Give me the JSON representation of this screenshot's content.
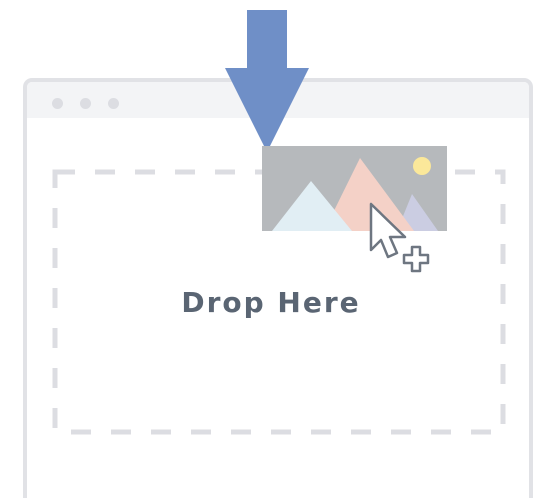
{
  "window": {
    "dots": [
      "dot-1",
      "dot-2",
      "dot-3"
    ]
  },
  "dropzone": {
    "label": "Drop Here"
  },
  "icons": {
    "arrow": "down-arrow-icon",
    "image": "image-thumbnail-icon",
    "cursor": "pointer-cursor-icon",
    "copy": "plus-copy-icon"
  },
  "colors": {
    "arrow": "#6f8fc7",
    "border": "#e1e2e6",
    "dashed": "#dcdde2",
    "text": "#5a6573",
    "thumb_bg": "#b6b9bc",
    "mountain_light": "#e1eef4",
    "mountain_pink": "#f4d1c7",
    "mountain_lavender": "#cbcde2",
    "sun": "#fbe89a"
  }
}
